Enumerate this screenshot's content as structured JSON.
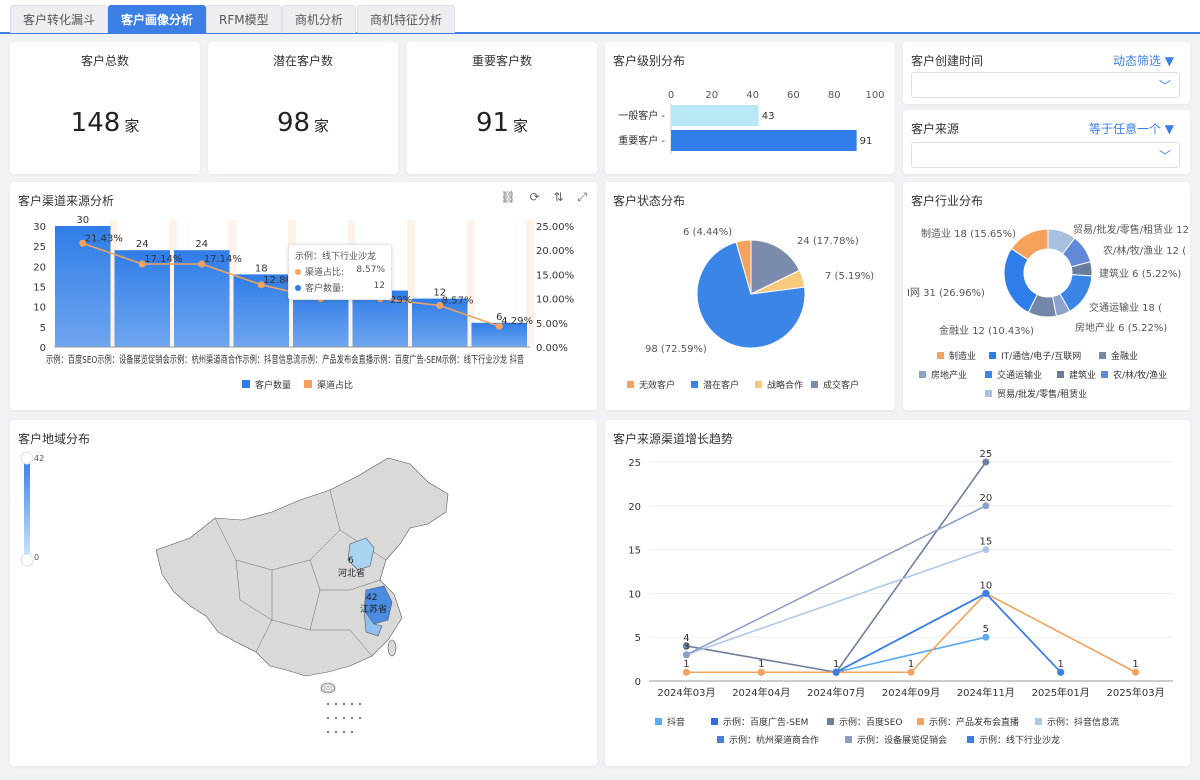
{
  "tabs": [
    {
      "label": "客户转化漏斗",
      "active": false
    },
    {
      "label": "客户画像分析",
      "active": true
    },
    {
      "label": "RFM模型",
      "active": false
    },
    {
      "label": "商机分析",
      "active": false
    },
    {
      "label": "商机特征分析",
      "active": false
    }
  ],
  "kpis": [
    {
      "title": "客户总数",
      "value": "148",
      "unit": "家"
    },
    {
      "title": "潜在客户数",
      "value": "98",
      "unit": "家"
    },
    {
      "title": "重要客户数",
      "value": "91",
      "unit": "家"
    }
  ],
  "filters": {
    "created": {
      "title": "客户创建时间",
      "action": "动态筛选 ▼",
      "chevron": "﹀"
    },
    "source": {
      "title": "客户来源",
      "action": "等于任意一个 ▼",
      "chevron": "﹀"
    }
  },
  "colors": {
    "accent": "#3a7ee6",
    "bar_light": "#a8e0f5",
    "orange": "#f5a25d"
  },
  "level_chart": {
    "title": "客户级别分布",
    "chart_data": {
      "type": "bar",
      "orientation": "horizontal",
      "categories": [
        "一般客户",
        "重要客户"
      ],
      "values": [
        43,
        91
      ],
      "xlim": [
        0,
        100
      ],
      "ticks": [
        0,
        20,
        40,
        60,
        80,
        100
      ],
      "colors": [
        "#b8e8f5",
        "#2f7de8"
      ]
    }
  },
  "channel_chart": {
    "title": "客户渠道来源分析",
    "chart_data": {
      "type": "bar",
      "categories": [
        "示例：百度SEO",
        "示例：设备展览促销会",
        "示例：杭州渠道商合作",
        "示例：抖音信息流",
        "示例：产品发布会直播",
        "示例：百度广告-SEM",
        "示例：线下行业沙龙",
        "抖音"
      ],
      "series": [
        {
          "name": "客户数量",
          "values": [
            30,
            24,
            24,
            18,
            14,
            14,
            12,
            6
          ]
        },
        {
          "name": "渠道占比",
          "values": [
            21.43,
            17.14,
            17.14,
            12.86,
            10.0,
            10.0,
            8.57,
            4.29
          ],
          "labels": [
            "21.43%",
            "17.14%",
            "17.14%",
            "12.86",
            "",
            "",
            "8.57%",
            "4.29%"
          ]
        }
      ],
      "y1_ticks": [
        "0",
        "5",
        "10",
        "15",
        "20",
        "25",
        "30"
      ],
      "y2_ticks": [
        "0.00%",
        "5.00%",
        "10.00%",
        "15.00%",
        "20.00%",
        "25.00%"
      ],
      "ylim": [
        0,
        30
      ],
      "y2lim": [
        0,
        25
      ],
      "x_tick_text": "示例：百度SEO示例：设备展览促销会示例：杭州渠道商合作示例：抖音信息流示例：产品发布会直播示例：百度广告-SEM示例：线下行业沙龙   抖音",
      "partial_label": "29%"
    },
    "tooltip": {
      "title": "示例：线下行业沙龙",
      "ratio_label": "渠道占比:",
      "ratio": "8.57%",
      "count_label": "客户数量:",
      "count": "12"
    },
    "legend": [
      "客户数量",
      "渠道占比"
    ]
  },
  "status_chart": {
    "title": "客户状态分布",
    "chart_data": {
      "type": "pie",
      "labels": [
        "无效客户",
        "潜在客户",
        "战略合作",
        "成交客户"
      ],
      "values": [
        6,
        98,
        7,
        24
      ],
      "pct": [
        "4.44%",
        "72.59%",
        "5.19%",
        "17.78%"
      ],
      "label_text": [
        "6 (4.44%)",
        "98 (72.59%)",
        "7 (5.19%)",
        "24 (17.78%)"
      ],
      "colors": [
        "#f5a25d",
        "#3a85e6",
        "#f7c97e",
        "#7b8bab"
      ]
    }
  },
  "industry_chart": {
    "title": "客户行业分布",
    "chart_data": {
      "type": "pie",
      "donut": true,
      "labels": [
        "制造业",
        "IT/通信/电子/互联网",
        "金融业",
        "房地产业",
        "交通运输业",
        "建筑业",
        "农/林/牧/渔业",
        "贸易/批发/零售/租赁业"
      ],
      "values": [
        18,
        31,
        12,
        6,
        18,
        6,
        12,
        12
      ],
      "colors": [
        "#f5a25d",
        "#2f7de8",
        "#7388a8",
        "#8da2c8",
        "#3a85e6",
        "#6a7d9e",
        "#6288d8",
        "#a9bfe0"
      ],
      "label_text": [
        "制造业 18 (15.65%)",
        "I网 31 (26.96%)",
        "金融业 12 (10.43%)",
        "房地产业 6 (5.22%)",
        "交通运输业 18 (",
        "建筑业 6 (5.22%)",
        "农/林/牧/渔业 12 (",
        "贸易/批发/零售/租赁业 12"
      ]
    }
  },
  "region_chart": {
    "title": "客户地域分布",
    "scale_max": "42",
    "scale_min": "0",
    "chart_data": {
      "type": "map",
      "regions": [
        {
          "name": "河北省",
          "value": 6
        },
        {
          "name": "江苏省",
          "value": 42
        }
      ]
    }
  },
  "trend_chart": {
    "title": "客户来源渠道增长趋势",
    "chart_data": {
      "type": "line",
      "x": [
        "2024年03月",
        "2024年04月",
        "2024年07月",
        "2024年09月",
        "2024年11月",
        "2025年01月",
        "2025年03月"
      ],
      "ylim": [
        0,
        25
      ],
      "y_ticks": [
        "0",
        "5",
        "10",
        "15",
        "20",
        "25"
      ],
      "series": [
        {
          "name": "抖音",
          "color": "#5aaaf0",
          "values": [
            null,
            null,
            1,
            null,
            5,
            null,
            null
          ]
        },
        {
          "name": "示例：百度广告-SEM",
          "color": "#2f6fd8",
          "values": [
            null,
            1,
            1,
            null,
            10,
            1,
            null
          ]
        },
        {
          "name": "示例：百度SEO",
          "color": "#6e7f9e",
          "values": [
            4,
            null,
            1,
            null,
            25,
            null,
            null
          ]
        },
        {
          "name": "示例：产品发布会直播",
          "color": "#f5a25d",
          "values": [
            1,
            1,
            null,
            1,
            10,
            null,
            1
          ]
        },
        {
          "name": "示例：抖音信息流",
          "color": "#b0c8e8",
          "values": [
            3,
            null,
            null,
            null,
            15,
            null,
            null
          ]
        },
        {
          "name": "示例：杭州渠道商合作",
          "color": "#4a7fd8",
          "values": [
            null,
            null,
            1,
            null,
            10,
            null,
            null
          ]
        },
        {
          "name": "示例：设备展览促销会",
          "color": "#8aa0c8",
          "values": [
            3,
            null,
            null,
            null,
            20,
            null,
            null
          ]
        },
        {
          "name": "示例：线下行业沙龙",
          "color": "#3a7ee6",
          "values": [
            null,
            null,
            1,
            null,
            10,
            1,
            null
          ]
        }
      ],
      "point_labels": [
        {
          "x": 0,
          "y": 4,
          "text": "4"
        },
        {
          "x": 0,
          "y": 3,
          "text": "3"
        },
        {
          "x": 0,
          "y": 1,
          "text": "1"
        },
        {
          "x": 1,
          "y": 1,
          "text": "1"
        },
        {
          "x": 2,
          "y": 1,
          "text": "1"
        },
        {
          "x": 3,
          "y": 1,
          "text": "1"
        },
        {
          "x": 4,
          "y": 25,
          "text": "25"
        },
        {
          "x": 4,
          "y": 20,
          "text": "20"
        },
        {
          "x": 4,
          "y": 15,
          "text": "15"
        },
        {
          "x": 4,
          "y": 10,
          "text": "10"
        },
        {
          "x": 4,
          "y": 5,
          "text": "5"
        },
        {
          "x": 5,
          "y": 1,
          "text": "1"
        },
        {
          "x": 6,
          "y": 1,
          "text": "1"
        }
      ]
    }
  }
}
